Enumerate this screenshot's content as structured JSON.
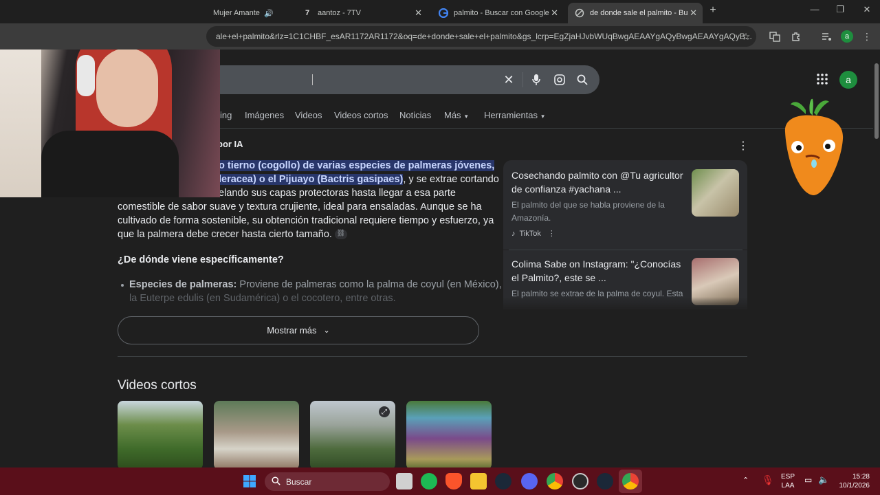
{
  "tabs": [
    {
      "title": "Mujer Amante",
      "active": false
    },
    {
      "title": "aantoz - 7TV",
      "active": false
    },
    {
      "title": "palmito - Buscar con Google",
      "active": false
    },
    {
      "title": "de donde sale el palmito - Busca",
      "active": true
    }
  ],
  "window": {
    "minimize": "—",
    "restore": "❐",
    "close": "✕",
    "newtab": "+"
  },
  "omnibox": {
    "url": "ale+el+palmito&rlz=1C1CHBF_esAR1172AR1172&oq=de+donde+sale+el+palmito&gs_lcrp=EgZjaHJvbWUqBwgAEAAYgAQyBwgAEAAYgAQyB..."
  },
  "profile_initial": "a",
  "search": {
    "placeholder": ""
  },
  "nav": [
    "ing",
    "Imágenes",
    "Videos",
    "Videos cortos",
    "Noticias",
    "Más",
    "Herramientas"
  ],
  "ai": {
    "header": "por IA",
    "line1_hl": "o tierno (cogollo) de varias especies de palmeras jóvenes,",
    "line2_hl": "leracea) o el Pijuayo (Bactris gasipaes)",
    "line2_rest": ", y se extrae cortando",
    "line3": "elando sus capas protectoras hasta llegar a esa parte",
    "line4": "comestible de sabor suave y textura crujiente, ideal para ensaladas. Aunque se ha",
    "line5": "cultivado de forma sostenible, su obtención tradicional requiere tiempo y esfuerzo, ya",
    "line6": "que la palmera debe crecer hasta cierto tamaño.",
    "subheading": "¿De dónde viene específicamente?",
    "bullet_bold": "Especies de palmeras:",
    "bullet_text": " Proviene de palmeras como la palma de coyul (en México),",
    "bullet_text2": "la Euterpe edulis (en Sudamérica) o el cocotero, entre otras.",
    "more_button": "Mostrar más"
  },
  "cards": [
    {
      "title": "Cosechando palmito con @Tu agricultor de confianza #yachana ...",
      "snippet": "El palmito del que se habla proviene de la Amazonía.",
      "source": "TikTok"
    },
    {
      "title": "Colima Sabe on Instagram: \"¿Conocías el Palmito?, este se ...",
      "snippet": "El palmito se extrae de la palma de coyul. Esta",
      "source": ""
    }
  ],
  "videos_heading": "Videos cortos",
  "taskbar": {
    "search_placeholder": "Buscar",
    "lang1": "ESP",
    "lang2": "LAA",
    "time": "15:28",
    "date": "10/1/2026"
  },
  "colors": {
    "accent": "#8ab4f8",
    "highlight": "#28366a",
    "taskbar": "#5a0f1a"
  }
}
